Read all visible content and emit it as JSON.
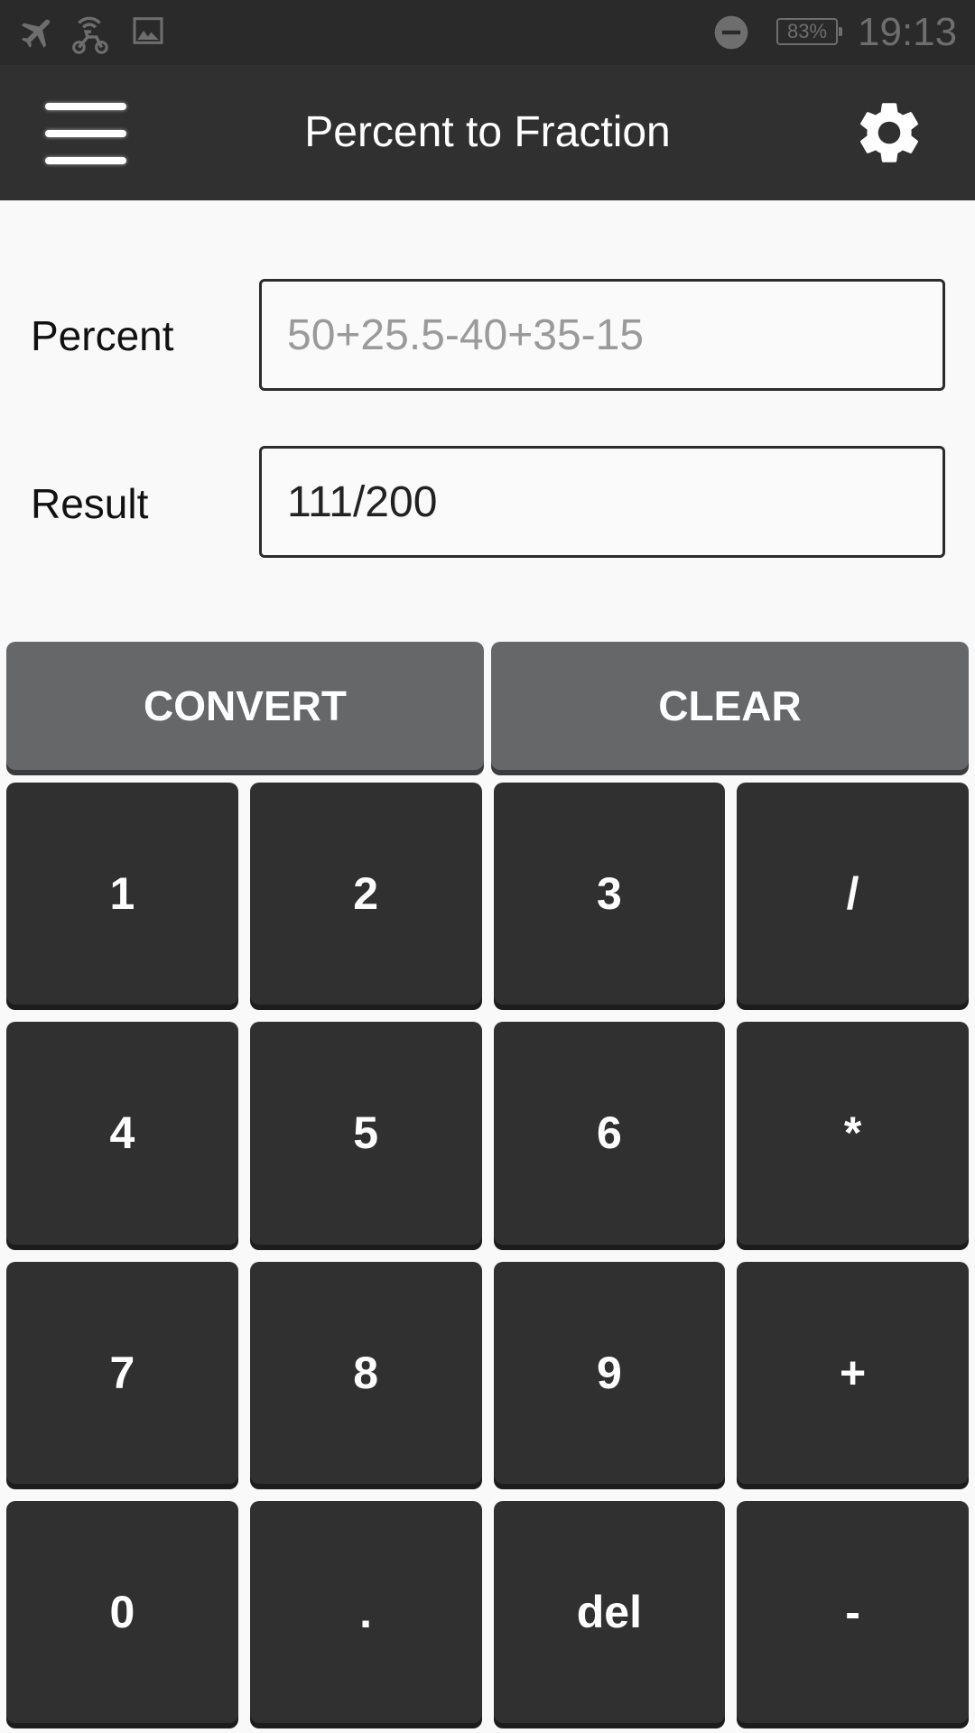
{
  "status_bar": {
    "battery": "83%",
    "time": "19:13"
  },
  "app_bar": {
    "title": "Percent to Fraction"
  },
  "form": {
    "percent_label": "Percent",
    "percent_placeholder": "50+25.5-40+35-15",
    "percent_value": "",
    "result_label": "Result",
    "result_value": "111/200"
  },
  "actions": {
    "convert": "CONVERT",
    "clear": "CLEAR"
  },
  "keypad": {
    "keys": [
      "1",
      "2",
      "3",
      "/",
      "4",
      "5",
      "6",
      "*",
      "7",
      "8",
      "9",
      "+",
      "0",
      ".",
      "del",
      "-"
    ]
  }
}
